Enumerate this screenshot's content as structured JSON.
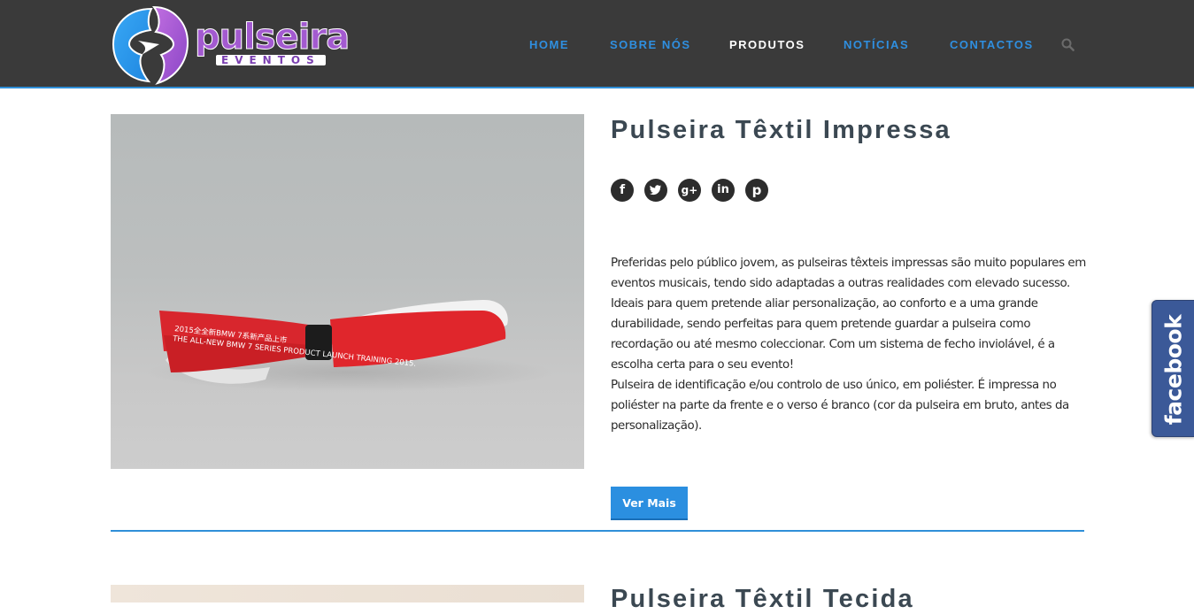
{
  "brand": {
    "name": "pulseira",
    "tagline": "EVENTOS"
  },
  "nav": {
    "items": [
      {
        "label": "HOME"
      },
      {
        "label": "SOBRE NÓS"
      },
      {
        "label": "PRODUTOS"
      },
      {
        "label": "NOTÍCIAS"
      },
      {
        "label": "CONTACTOS"
      }
    ],
    "active": "PRODUTOS",
    "search_icon": "search-icon"
  },
  "product": {
    "title": "Pulseira Têxtil Impressa",
    "image_text_line1": "2015全全新BMW 7系新产品上市",
    "image_text_line2": "THE ALL-NEW BMW 7 SERIES PRODUCT LAUNCH TRAINING 2015.",
    "share_icons": [
      "facebook-icon",
      "twitter-icon",
      "google-plus-icon",
      "linkedin-icon",
      "pinterest-icon"
    ],
    "description_p1": "Preferidas pelo público jovem, as pulseiras têxteis impressas são muito populares em eventos musicais, tendo sido adaptadas a outras realidades com elevado sucesso. Ideais para quem pretende aliar personalização, ao conforto e a uma grande durabilidade, sendo perfeitas para quem pretende guardar a pulseira como recordação ou até mesmo coleccionar. Com um sistema de fecho inviolável, é a escolha certa para o seu evento!",
    "description_p2": "Pulseira de identificação e/ou controlo de uso único, em poliéster. É impressa no poliéster na parte da frente e o verso é branco (cor da pulseira em bruto, antes da personalização).",
    "button_label": "Ver Mais"
  },
  "next_product": {
    "title": "Pulseira Têxtil Tecida"
  },
  "facebook_tab": {
    "label": "facebook"
  },
  "colors": {
    "header_bg": "#3a3a3a",
    "accent": "#2b8fe0",
    "title": "#3b4852",
    "facebook": "#3b5998"
  }
}
